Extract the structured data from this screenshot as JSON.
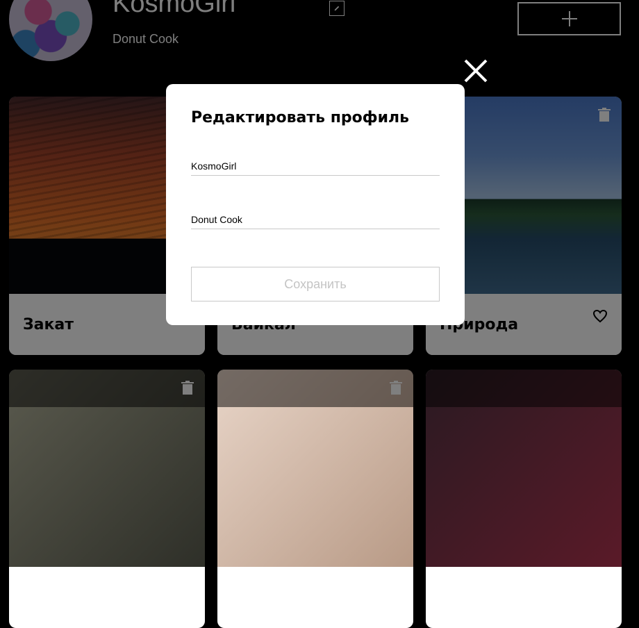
{
  "profile": {
    "name": "KosmoGirl",
    "job": "Donut Cook"
  },
  "header": {
    "edit_icon": "pencil-icon",
    "add_icon": "plus-icon"
  },
  "cards": [
    {
      "title": "Закат"
    },
    {
      "title": "Байкал"
    },
    {
      "title": "Природа"
    }
  ],
  "modal": {
    "title": "Редактировать профиль",
    "name_value": "KosmoGirl",
    "job_value": "Donut Cook",
    "save_label": "Сохранить",
    "close_icon": "close-icon"
  },
  "colors": {
    "page_bg": "#000000",
    "modal_bg": "#ffffff",
    "disabled_text": "#c4c4c4"
  }
}
